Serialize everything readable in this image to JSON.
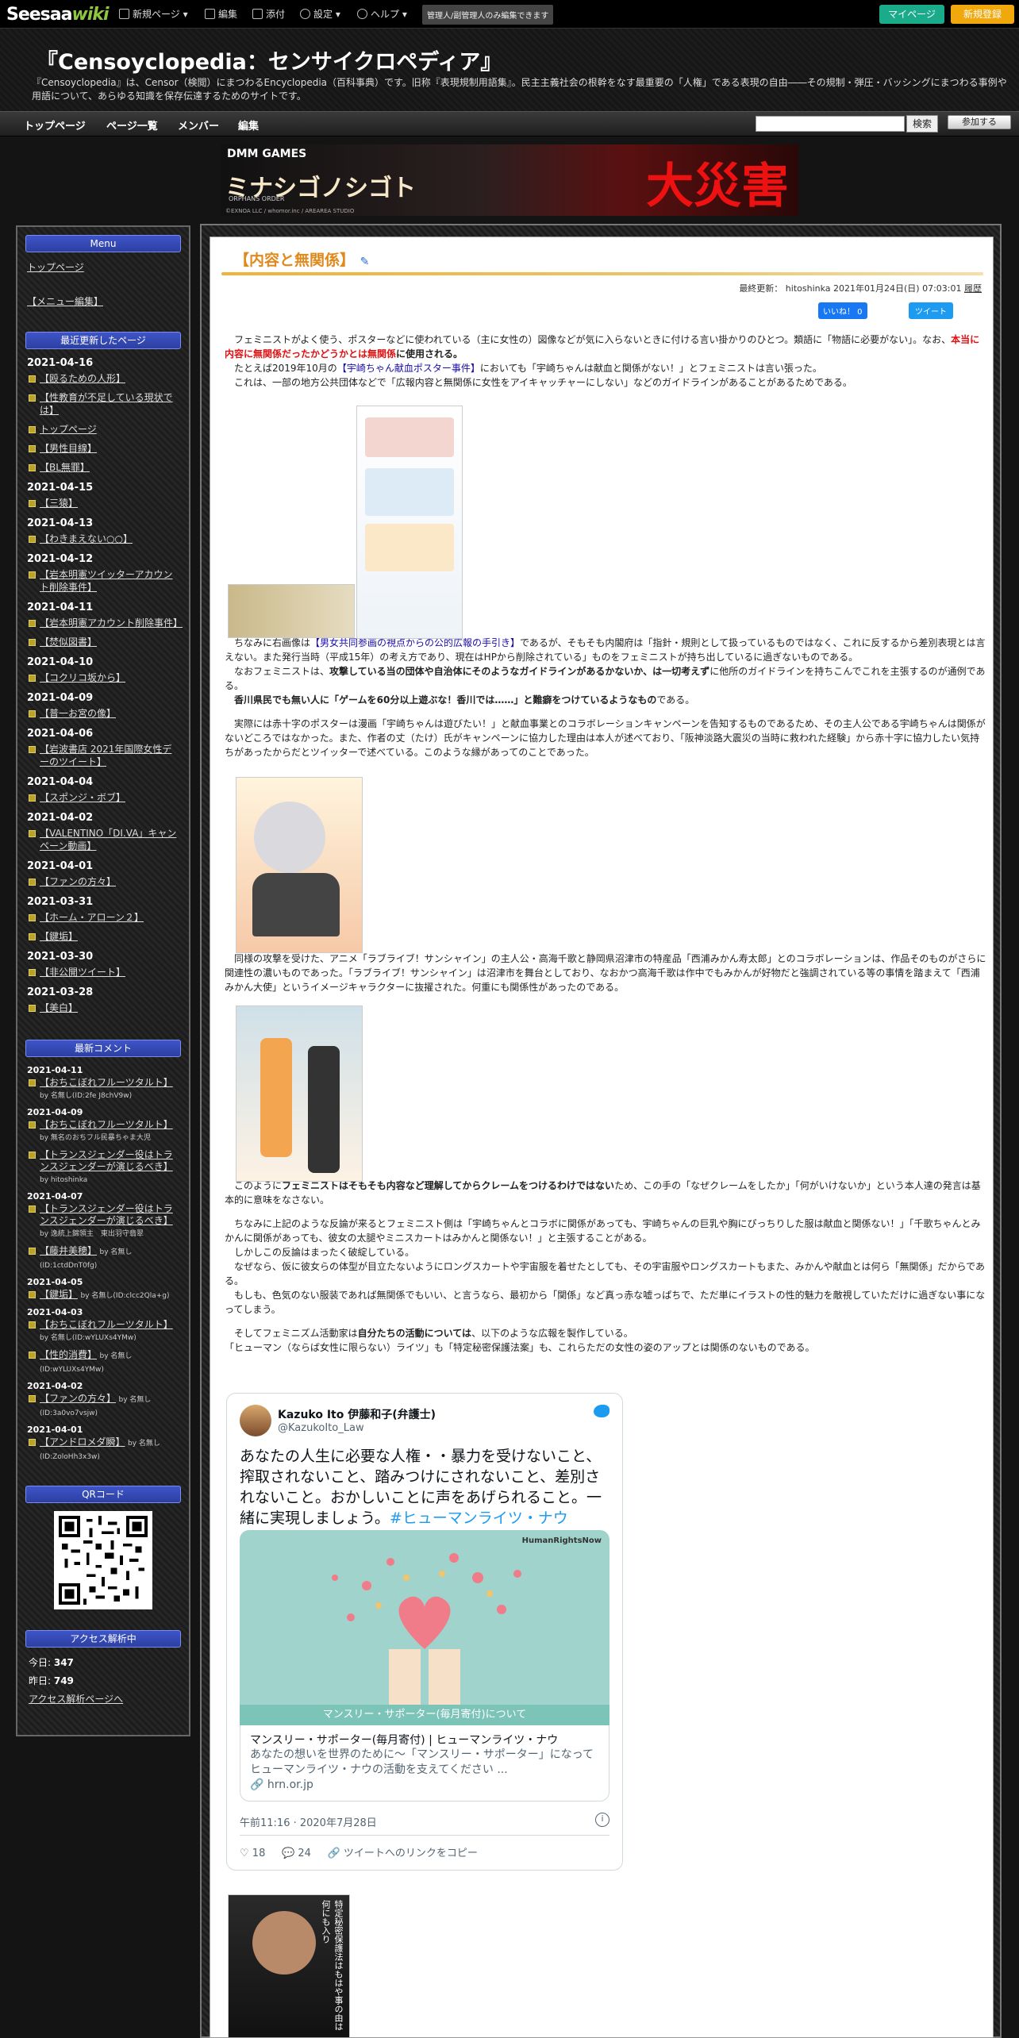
{
  "topbar": {
    "logo_main": "Seesaa",
    "logo_sub": "wiki",
    "new_page": "新規ページ",
    "edit": "編集",
    "attach": "添付",
    "settings": "設定",
    "help": "ヘルプ",
    "admin_note": "管理人/副管理人のみ編集できます",
    "mypage": "マイページ",
    "register": "新規登録"
  },
  "header": {
    "title": "『Censoyclopedia：センサイクロペディア』",
    "desc": "『Censoyclopedia』は、Censor（検閲）にまつわるEncyclopedia（百科事典）です。旧称『表現規制用語集』。民主主義社会の根幹をなす最重要の「人権」である表現の自由――その規制・弾圧・バッシングにまつわる事例や用語について、あらゆる知識を保存伝達するためのサイトです。"
  },
  "nav": {
    "items": [
      "トップページ",
      "ページ一覧",
      "メンバー",
      "編集"
    ],
    "search_btn": "検索",
    "join": "参加する"
  },
  "ad": {
    "brand": "DMM GAMES",
    "game": "ミナシゴノシゴト",
    "sub": "ORPHANS ORDER",
    "copy": "©EXNOA LLC / whomor.inc / AREAREA STUDIO",
    "big": "大災害"
  },
  "sidebar": {
    "menu_head": "Menu",
    "menu_items": [
      "トップページ",
      "【メニュー編集】"
    ],
    "recent_head": "最近更新したページ",
    "recent": [
      {
        "date": "2021-04-16",
        "items": [
          "【殴るための人形】",
          "【性教育が不足している現状では】",
          "トップページ",
          "【男性目線】",
          "【BL無罪】"
        ]
      },
      {
        "date": "2021-04-15",
        "items": [
          "【三猿】"
        ]
      },
      {
        "date": "2021-04-13",
        "items": [
          "【わきまえない○○】"
        ]
      },
      {
        "date": "2021-04-12",
        "items": [
          "【岩本明憲ツイッターアカウント削除事件】"
        ]
      },
      {
        "date": "2021-04-11",
        "items": [
          "【岩本明憲アカウント削除事件】",
          "【焚似図書】"
        ]
      },
      {
        "date": "2021-04-10",
        "items": [
          "【コクリコ坂から】"
        ]
      },
      {
        "date": "2021-04-09",
        "items": [
          "【普一お宮の像】"
        ]
      },
      {
        "date": "2021-04-06",
        "items": [
          "【岩波書店 2021年国際女性デーのツイート】"
        ]
      },
      {
        "date": "2021-04-04",
        "items": [
          "【スポンジ・ボブ】"
        ]
      },
      {
        "date": "2021-04-02",
        "items": [
          "【VALENTINO「DI.VA」キャンペーン動画】"
        ]
      },
      {
        "date": "2021-04-01",
        "items": [
          "【ファンの方々】"
        ]
      },
      {
        "date": "2021-03-31",
        "items": [
          "【ホーム・アローン２】",
          "【鍵垢】"
        ]
      },
      {
        "date": "2021-03-30",
        "items": [
          "【非公開ツイート】"
        ]
      },
      {
        "date": "2021-03-28",
        "items": [
          "【美白】"
        ]
      }
    ],
    "comments_head": "最新コメント",
    "comments": [
      {
        "date": "2021-04-11",
        "items": [
          {
            "t": "【おちこぼれフルーツタルト】",
            "b": "by 名無し(ID:2fe J8chV9w)"
          }
        ]
      },
      {
        "date": "2021-04-09",
        "items": [
          {
            "t": "【おちこぼれフルーツタルト】",
            "b": "by 無名のおちフル民暴ちゃま大児"
          },
          {
            "t": "【トランスジェンダー役はトランスジェンダーが演じるべき】",
            "b": "by hitoshinka"
          }
        ]
      },
      {
        "date": "2021-04-07",
        "items": [
          {
            "t": "【トランスジェンダー役はトランスジェンダーが演じるべき】",
            "b": "by 逸統上錦領主　東出羽守翡翠"
          },
          {
            "t": "【藤井美穂】",
            "b": "by 名無し(ID:1ctdDnT0fg)"
          }
        ]
      },
      {
        "date": "2021-04-05",
        "items": [
          {
            "t": "【鍵垢】",
            "b": "by 名無し(ID:clcc2Qla+g)"
          }
        ]
      },
      {
        "date": "2021-04-03",
        "items": [
          {
            "t": "【おちこぼれフルーツタルト】",
            "b": "by 名無し(ID:wYLUXs4YMw)"
          },
          {
            "t": "【性的消費】",
            "b": "by 名無し(ID:wYLUXs4YMw)"
          }
        ]
      },
      {
        "date": "2021-04-02",
        "items": [
          {
            "t": "【ファンの方々】",
            "b": "by 名無し(ID:3a0vo7vsjw)"
          }
        ]
      },
      {
        "date": "2021-04-01",
        "items": [
          {
            "t": "【アンドロメダ瞬】",
            "b": "by 名無し(ID:ZoloHh3x3w)"
          }
        ]
      }
    ],
    "qr_head": "QRコード",
    "access_head": "アクセス解析中",
    "today_label": "今日: ",
    "today_value": "347",
    "yesterday_label": "昨日: ",
    "yesterday_value": "749",
    "access_link": "アクセス解析ページへ"
  },
  "article": {
    "title": "【内容と無関係】",
    "meta": "最終更新： hitoshinka 2021年01月24日(日) 07:03:01",
    "history": "履歴",
    "like": "いいね！ 0",
    "tweet": "ツイート",
    "p1a": "フェミニストがよく使う、ポスターなどに使われている（主に女性の）図像などが気に入らないときに付ける言い掛かりのひとつ。類語に「物語に必要がない」。なお、",
    "p1red": "本当に内容に無関係だったかどうかとは無関係",
    "p1b": "に使用される。",
    "p2a": "たとえば2019年10月の",
    "p2link": "【宇崎ちゃん献血ポスター事件】",
    "p2b": "においても「宇崎ちゃんは献血と関係がない！」とフェミニストは言い張った。",
    "p3": "これは、一部の地方公共団体などで「広報内容と無関係に女性をアイキャッチャーにしない」などのガイドラインがあることがあるためである。",
    "p4a": "ちなみに右画像は",
    "p4link": "【男女共同参画の視点からの公的広報の手引き】",
    "p4b": "であるが、そもそも内閣府は「指針・規則として扱っているものではなく、これに反するから差別表現とは言えない。また発行当時（平成15年）の考え方であり、現在はHPから削除されている」ものをフェミニストが持ち出しているに過ぎないものである。",
    "p5a": "なおフェミニストは、",
    "p5bold": "攻撃している当の団体や自治体にそのようなガイドラインがあるかないか、は一切考えず",
    "p5b": "に他所のガイドラインを持ちこんでこれを主張するのが通例である。",
    "p6bold": "香川県民でも無い人に「ゲームを60分以上遊ぶな！香川では……」と難癖をつけているようなもの",
    "p6b": "である。",
    "p7": "実際には赤十字のポスターは漫画「宇崎ちゃんは遊びたい！」と献血事業とのコラボレーションキャンペーンを告知するものであるため、その主人公である宇崎ちゃんは関係がないどころではなかった。また、作者の丈（たけ）氏がキャンペーンに協力した理由は本人が述べており、「阪神淡路大震災の当時に救われた経験」から赤十字に協力したい気持ちがあったからだとツイッターで述べている。このような縁があってのことであった。",
    "p8": "同様の攻撃を受けた、アニメ「ラブライブ！サンシャイン」の主人公・高海千歌と静岡県沼津市の特産品「西浦みかん寿太郎」とのコラボレーションは、作品そのものがさらに関連性の濃いものであった。「ラブライブ！サンシャイン」は沼津市を舞台としており、なおかつ高海千歌は作中でもみかんが好物だと強調されている等の事情を踏まえて「西浦みかん大使」というイメージキャラクターに抜擢された。何重にも関係性があったのである。",
    "p9a": "このように",
    "p9bold": "フェミニストはそもそも内容など理解してからクレームをつけるわけではない",
    "p9b": "ため、この手の「なぜクレームをしたか」「何がいけないか」という本人達の発言は基本的に意味をなさない。",
    "p10": "ちなみに上記のような反論が来るとフェミニスト側は「宇崎ちゃんとコラボに関係があっても、宇崎ちゃんの巨乳や胸にぴっちりした服は献血と関係ない！」「千歌ちゃんとみかんに関係があっても、彼女の太腿やミニスカートはみかんと関係ない！」と主張することがある。",
    "p11": "しかしこの反論はまったく破綻している。",
    "p12": "なぜなら、仮に彼女らの体型が目立たないようにロングスカートや宇宙服を着せたとしても、その宇宙服やロングスカートもまた、みかんや献血とは何ら「無関係」だからである。",
    "p13": "もしも、色気のない服装であれば無関係でもいい、と言うなら、最初から「関係」など真っ赤な嘘っぱちで、ただ単にイラストの性的魅力を敵視していただけに過ぎない事になってしまう。",
    "p14a": "そしてフェミニズム活動家は",
    "p14bold": "自分たちの活動については",
    "p14b": "、以下のような広報を製作している。",
    "p15": "「ヒューマン（ならば女性に限らない）ライツ」も「特定秘密保護法案」も、これらただの女性の姿のアップとは関係のないものである。"
  },
  "tweet": {
    "name": "Kazuko Ito 伊藤和子(弁護士)",
    "handle": "@KazukoIto_Law",
    "text": "あなたの人生に必要な人権・・暴力を受けないこと、搾取されないこと、踏みつけにされないこと、差別されないこと。おかしいことに声をあげられること。一緒に実現しましょう。",
    "tag": "#ヒューマンライツ・ナウ",
    "img_brand": "HumanRightsNow",
    "img_caption": "マンスリー・サポーター(毎月寄付)について",
    "link_title": "マンスリー・サポーター(毎月寄付) | ヒューマンライツ・ナウ",
    "link_desc": "あなたの想いを世界のために～「マンスリー・サポーター」になって ヒューマンライツ・ナウの活動を支えてください ...",
    "link_domain": "hrn.or.jp",
    "time": "午前11:16 · 2020年7月28日",
    "likes": "18",
    "replies": "24",
    "copy": "ツイートへのリンクをコピー"
  },
  "bottom_caption": "特定秘密保護法はもはや事の由は何にも入り"
}
